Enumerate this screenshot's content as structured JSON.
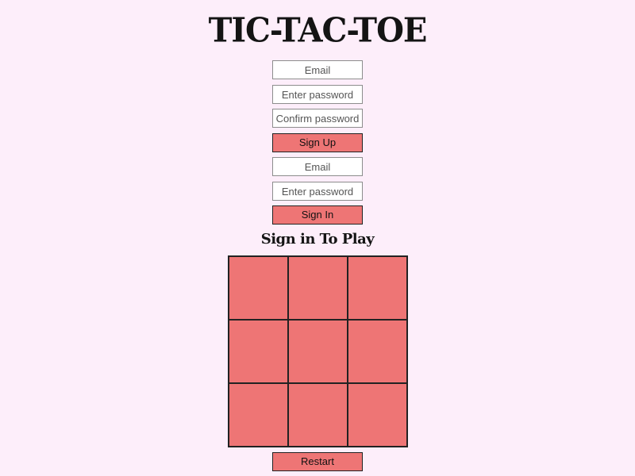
{
  "header": {
    "title": "TIC-TAC-TOE"
  },
  "sign_up": {
    "email_placeholder": "Email",
    "password_placeholder": "Enter password",
    "confirm_placeholder": "Confirm password",
    "button_label": "Sign Up"
  },
  "sign_in": {
    "email_placeholder": "Email",
    "password_placeholder": "Enter password",
    "button_label": "Sign In"
  },
  "game": {
    "status": "Sign in To Play",
    "cells": [
      "",
      "",
      "",
      "",
      "",
      "",
      "",
      "",
      ""
    ],
    "restart_label": "Restart"
  },
  "colors": {
    "background": "#fdeefa",
    "accent": "#ee7575"
  }
}
